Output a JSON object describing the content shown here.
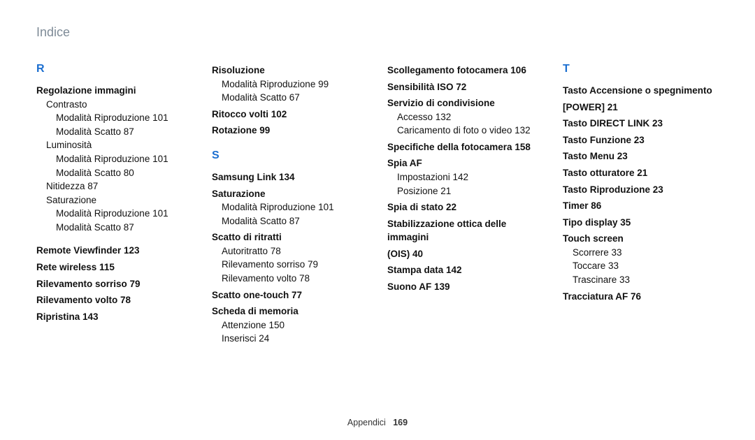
{
  "header": {
    "title": "Indice"
  },
  "footer": {
    "section": "Appendici",
    "page": "169"
  },
  "col1": {
    "letter": "R",
    "regolazione": "Regolazione immagini",
    "contrasto": "Contrasto",
    "contrasto_rip": "Modalità Riproduzione  101",
    "contrasto_sc": "Modalità Scatto  87",
    "lum": "Luminosità",
    "lum_rip": "Modalità Riproduzione  101",
    "lum_sc": "Modalità Scatto  80",
    "nit": "Nitidezza  87",
    "sat": "Saturazione",
    "sat_rip": "Modalità Riproduzione  101",
    "sat_sc": "Modalità Scatto  87",
    "remote": "Remote Viewfinder  123",
    "rete": "Rete wireless  115",
    "sorriso": "Rilevamento sorriso  79",
    "volto": "Rilevamento volto  78",
    "ripristina": "Ripristina  143"
  },
  "col2": {
    "risoluzione": "Risoluzione",
    "riso_rip": "Modalità Riproduzione  99",
    "riso_sc": "Modalità Scatto  67",
    "ritocco": "Ritocco volti  102",
    "rotazione": "Rotazione  99",
    "letter": "S",
    "samsung": "Samsung Link  134",
    "saturazione": "Saturazione",
    "sat2_rip": "Modalità Riproduzione  101",
    "sat2_sc": "Modalità Scatto  87",
    "ritratti": "Scatto di ritratti",
    "ritr_auto": "Autoritratto  78",
    "ritr_sorriso": "Rilevamento sorriso  79",
    "ritr_volto": "Rilevamento volto  78",
    "onetouch": "Scatto one-touch  77",
    "memoria": "Scheda di memoria",
    "mem_att": "Attenzione  150",
    "mem_ins": "Inserisci  24"
  },
  "col3": {
    "scoll": "Scollegamento fotocamera  106",
    "iso": "Sensibilità ISO  72",
    "servizio": "Servizio di condivisione",
    "serv_acc": "Accesso  132",
    "serv_car": "Caricamento di foto o video  132",
    "spec": "Specifiche della fotocamera  158",
    "spiaaf": "Spia AF",
    "spia_imp": "Impostazioni  142",
    "spia_pos": "Posizione  21",
    "spiastato": "Spia di stato  22",
    "ois1": "Stabilizzazione ottica delle immagini",
    "ois2": "(OIS)  40",
    "stampa": "Stampa data  142",
    "suono": "Suono AF  139"
  },
  "col4": {
    "letter": "T",
    "power1": "Tasto Accensione o spegnimento",
    "power2": "[POWER]  21",
    "direct": "Tasto DIRECT LINK  23",
    "funzione": "Tasto Funzione  23",
    "menu": "Tasto Menu  23",
    "otturatore": "Tasto otturatore  21",
    "riproduzione": "Tasto Riproduzione  23",
    "timer": "Timer  86",
    "display": "Tipo display  35",
    "touch": "Touch screen",
    "touch_scroll": "Scorrere  33",
    "touch_tap": "Toccare  33",
    "touch_drag": "Trascinare  33",
    "tracc": "Tracciatura AF  76"
  }
}
